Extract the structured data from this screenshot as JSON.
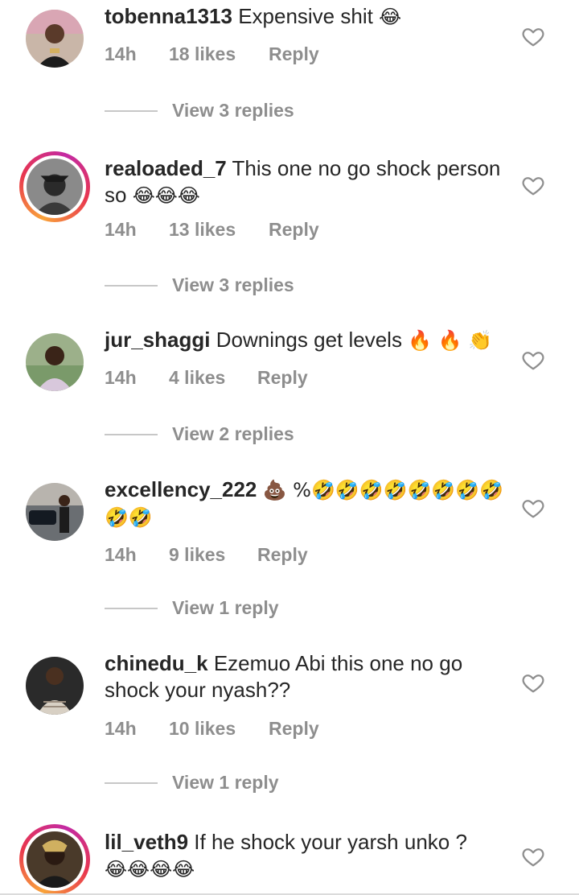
{
  "comments": [
    {
      "username": "tobenna1313",
      "text": "Expensive shit",
      "emoji": "😂",
      "time": "14h",
      "likes": "18 likes",
      "reply": "Reply",
      "view_replies": "View 3 replies"
    },
    {
      "username": "realoaded_7",
      "text": "This one no go shock person so",
      "emoji": "😂😂😂",
      "time": "14h",
      "likes": "13 likes",
      "reply": "Reply",
      "view_replies": "View 3 replies"
    },
    {
      "username": "jur_shaggi",
      "text": "Downings get levels",
      "emoji": "🔥 🔥 👏",
      "time": "14h",
      "likes": "4 likes",
      "reply": "Reply",
      "view_replies": "View 2 replies"
    },
    {
      "username": "excellency_222",
      "text": "💩 %🤣🤣🤣🤣🤣🤣🤣🤣🤣🤣",
      "emoji": "",
      "time": "14h",
      "likes": "9 likes",
      "reply": "Reply",
      "view_replies": "View 1 reply"
    },
    {
      "username": "chinedu_k",
      "text": "Ezemuo Abi this one no go shock your nyash??",
      "emoji": "",
      "time": "14h",
      "likes": "10 likes",
      "reply": "Reply",
      "view_replies": "View 1 reply"
    },
    {
      "username": "lil_veth9",
      "text": "If he shock your yarsh unko ?",
      "emoji": "😂😂😂😂",
      "time": "",
      "likes": "",
      "reply": "",
      "view_replies": ""
    }
  ],
  "icons": {
    "like": "heart-outline-icon"
  },
  "colors": {
    "text": "#262626",
    "secondary": "#8e8e8e",
    "story_ring_start": "#f9a33a",
    "story_ring_end": "#c32aa3"
  }
}
